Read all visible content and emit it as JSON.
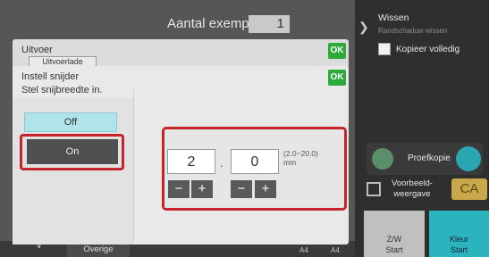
{
  "header": {
    "copies_label": "Aantal exempl.",
    "copies_value": "1"
  },
  "right_panel": {
    "wissen": "Wissen",
    "wissen_sub": "Randschaduw wissen",
    "kopieer_volledig": "Kopieer volledig",
    "proefkopie": "Proefkopie",
    "preview_line1": "Voorbeeld-",
    "preview_line2": "weergave",
    "ca": "CA",
    "zw_line1": "Z/W",
    "zw_line2": "Start",
    "kleur_line1": "Kleur",
    "kleur_line2": "Start"
  },
  "bottom": {
    "overige": "Overige",
    "paper1": "A4",
    "paper2": "A4"
  },
  "dialog_output": {
    "title": "Uitvoer",
    "tab": "Uitvoerlade",
    "ok": "OK"
  },
  "dialog_cutter": {
    "title_line1": "Instell snijder",
    "title_line2": "Stel snijbreedte in.",
    "ok": "OK",
    "off_label": "Off",
    "on_label": "On",
    "selected": "On",
    "integer_value": "2",
    "separator": ".",
    "decimal_value": "0",
    "range_line1": "(2.0~20.0)",
    "range_line2": "mm",
    "minus": "−",
    "plus": "+"
  },
  "colors": {
    "highlight": "#c4242b",
    "ok_green": "#2eaa3a",
    "off_button": "#aee4ea",
    "kleur_start": "#2bb4be",
    "ca_button": "#c8a84a"
  }
}
